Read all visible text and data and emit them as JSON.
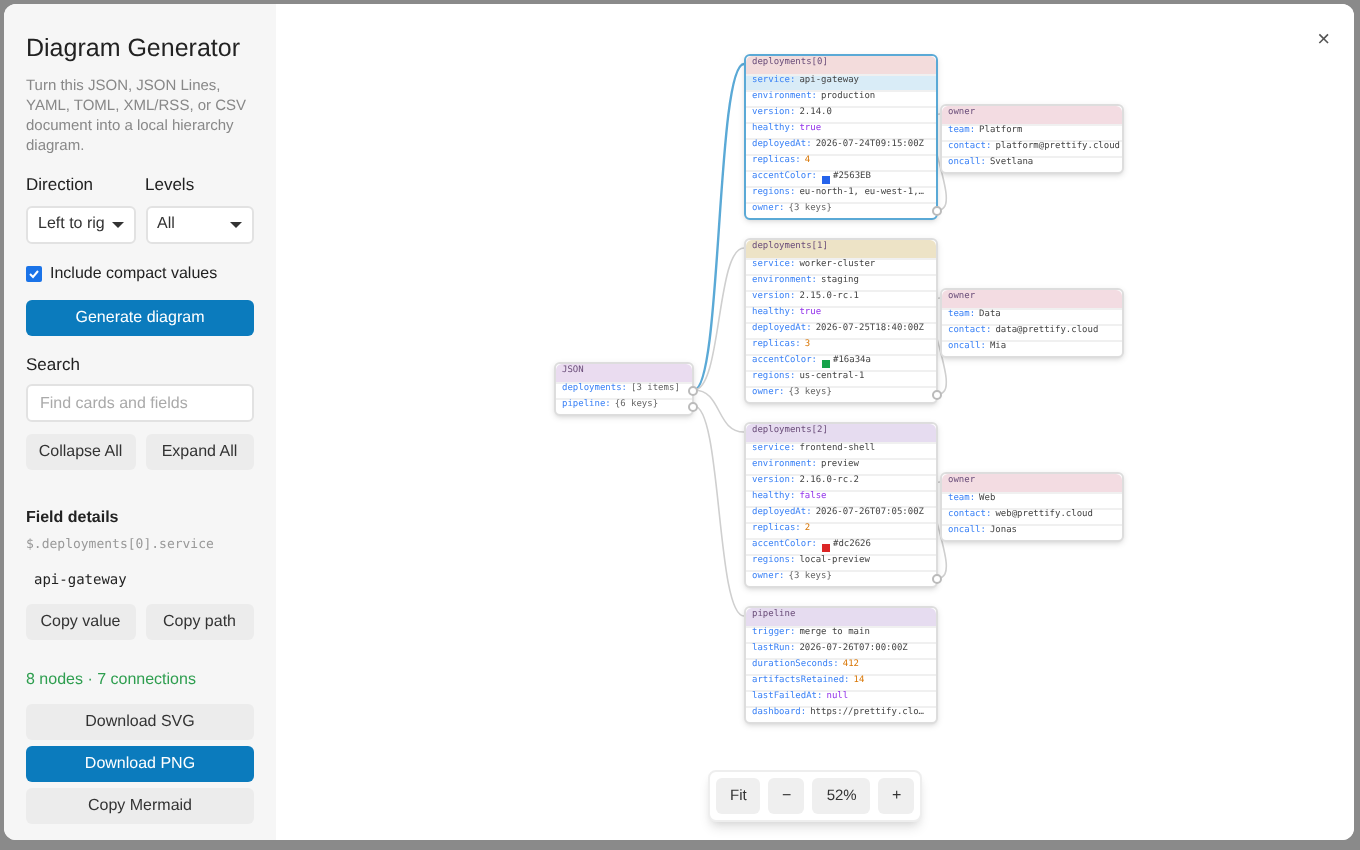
{
  "sidebar": {
    "title": "Diagram Generator",
    "description": "Turn this JSON, JSON Lines, YAML, TOML, XML/RSS, or CSV document into a local hierarchy diagram.",
    "direction": {
      "label": "Direction",
      "value": "Left to rig"
    },
    "levels": {
      "label": "Levels",
      "value": "All"
    },
    "compact": {
      "label": "Include compact values",
      "checked": true
    },
    "generate_button": "Generate diagram",
    "search": {
      "label": "Search",
      "placeholder": "Find cards and fields"
    },
    "tree_buttons": [
      "Collapse All",
      "Expand All"
    ],
    "field_details": {
      "title": "Field details",
      "path": "$.deployments[0].service",
      "value": "api-gateway"
    },
    "copy_buttons": [
      "Copy value",
      "Copy path"
    ],
    "stats": "8 nodes · 7 connections",
    "export_buttons": [
      {
        "label": "Download SVG",
        "kind": "secondary"
      },
      {
        "label": "Download PNG",
        "kind": "primary"
      },
      {
        "label": "Copy Mermaid",
        "kind": "secondary"
      }
    ]
  },
  "diagram": {
    "root": {
      "title": "JSON",
      "color": "#eadcf0",
      "selected": false,
      "rows": [
        {
          "key": "deployments:",
          "value": "[3 items]",
          "kind": "ref",
          "selected": false,
          "children": [
            {
              "title": "deployments[0]",
              "color": "#f3dcdc",
              "selected": true,
              "rows": [
                {
                  "key": "service:",
                  "value": "api-gateway",
                  "kind": "string",
                  "selected": true
                },
                {
                  "key": "environment:",
                  "value": "production",
                  "kind": "string",
                  "selected": false
                },
                {
                  "key": "version:",
                  "value": "2.14.0",
                  "kind": "string",
                  "selected": false
                },
                {
                  "key": "healthy:",
                  "value": "true",
                  "kind": "boolean",
                  "selected": false
                },
                {
                  "key": "deployedAt:",
                  "value": "2026-07-24T09:15:00Z",
                  "kind": "string",
                  "selected": false
                },
                {
                  "key": "replicas:",
                  "value": "4",
                  "kind": "number",
                  "selected": false
                },
                {
                  "key": "accentColor:",
                  "value": "#2563EB",
                  "kind": "color",
                  "color": "#2563eb",
                  "selected": false
                },
                {
                  "key": "regions:",
                  "value": "eu-north-1, eu-west-1,…",
                  "kind": "string",
                  "selected": false
                },
                {
                  "key": "owner:",
                  "value": "{3 keys}",
                  "kind": "ref",
                  "selected": false,
                  "children": [
                    {
                      "title": "owner",
                      "color": "#f3dce2",
                      "selected": false,
                      "rows": [
                        {
                          "key": "team:",
                          "value": "Platform",
                          "kind": "string",
                          "selected": false
                        },
                        {
                          "key": "contact:",
                          "value": "platform@prettify.cloud",
                          "kind": "string",
                          "selected": false
                        },
                        {
                          "key": "oncall:",
                          "value": "Svetlana",
                          "kind": "string",
                          "selected": false
                        }
                      ]
                    }
                  ]
                }
              ]
            },
            {
              "title": "deployments[1]",
              "color": "#ede3c6",
              "selected": false,
              "rows": [
                {
                  "key": "service:",
                  "value": "worker-cluster",
                  "kind": "string",
                  "selected": false
                },
                {
                  "key": "environment:",
                  "value": "staging",
                  "kind": "string",
                  "selected": false
                },
                {
                  "key": "version:",
                  "value": "2.15.0-rc.1",
                  "kind": "string",
                  "selected": false
                },
                {
                  "key": "healthy:",
                  "value": "true",
                  "kind": "boolean",
                  "selected": false
                },
                {
                  "key": "deployedAt:",
                  "value": "2026-07-25T18:40:00Z",
                  "kind": "string",
                  "selected": false
                },
                {
                  "key": "replicas:",
                  "value": "3",
                  "kind": "number",
                  "selected": false
                },
                {
                  "key": "accentColor:",
                  "value": "#16a34a",
                  "kind": "color",
                  "color": "#16a34a",
                  "selected": false
                },
                {
                  "key": "regions:",
                  "value": "us-central-1",
                  "kind": "string",
                  "selected": false
                },
                {
                  "key": "owner:",
                  "value": "{3 keys}",
                  "kind": "ref",
                  "selected": false,
                  "children": [
                    {
                      "title": "owner",
                      "color": "#f3dce2",
                      "selected": false,
                      "rows": [
                        {
                          "key": "team:",
                          "value": "Data",
                          "kind": "string",
                          "selected": false
                        },
                        {
                          "key": "contact:",
                          "value": "data@prettify.cloud",
                          "kind": "string",
                          "selected": false
                        },
                        {
                          "key": "oncall:",
                          "value": "Mia",
                          "kind": "string",
                          "selected": false
                        }
                      ]
                    }
                  ]
                }
              ]
            },
            {
              "title": "deployments[2]",
              "color": "#e6dcf0",
              "selected": false,
              "rows": [
                {
                  "key": "service:",
                  "value": "frontend-shell",
                  "kind": "string",
                  "selected": false
                },
                {
                  "key": "environment:",
                  "value": "preview",
                  "kind": "string",
                  "selected": false
                },
                {
                  "key": "version:",
                  "value": "2.16.0-rc.2",
                  "kind": "string",
                  "selected": false
                },
                {
                  "key": "healthy:",
                  "value": "false",
                  "kind": "boolean",
                  "selected": false
                },
                {
                  "key": "deployedAt:",
                  "value": "2026-07-26T07:05:00Z",
                  "kind": "string",
                  "selected": false
                },
                {
                  "key": "replicas:",
                  "value": "2",
                  "kind": "number",
                  "selected": false
                },
                {
                  "key": "accentColor:",
                  "value": "#dc2626",
                  "kind": "color",
                  "color": "#dc2626",
                  "selected": false
                },
                {
                  "key": "regions:",
                  "value": "local-preview",
                  "kind": "string",
                  "selected": false
                },
                {
                  "key": "owner:",
                  "value": "{3 keys}",
                  "kind": "ref",
                  "selected": false,
                  "children": [
                    {
                      "title": "owner",
                      "color": "#f3dce2",
                      "selected": false,
                      "rows": [
                        {
                          "key": "team:",
                          "value": "Web",
                          "kind": "string",
                          "selected": false
                        },
                        {
                          "key": "contact:",
                          "value": "web@prettify.cloud",
                          "kind": "string",
                          "selected": false
                        },
                        {
                          "key": "oncall:",
                          "value": "Jonas",
                          "kind": "string",
                          "selected": false
                        }
                      ]
                    }
                  ]
                }
              ]
            }
          ]
        },
        {
          "key": "pipeline:",
          "value": "{6 keys}",
          "kind": "ref",
          "selected": false,
          "children": [
            {
              "title": "pipeline",
              "color": "#e6dcf0",
              "selected": false,
              "rows": [
                {
                  "key": "trigger:",
                  "value": "merge to main",
                  "kind": "string",
                  "selected": false
                },
                {
                  "key": "lastRun:",
                  "value": "2026-07-26T07:00:00Z",
                  "kind": "string",
                  "selected": false
                },
                {
                  "key": "durationSeconds:",
                  "value": "412",
                  "kind": "number",
                  "selected": false
                },
                {
                  "key": "artifactsRetained:",
                  "value": "14",
                  "kind": "number",
                  "selected": false
                },
                {
                  "key": "lastFailedAt:",
                  "value": "null",
                  "kind": "null",
                  "selected": false
                },
                {
                  "key": "dashboard:",
                  "value": "https://prettify.clo…",
                  "kind": "string",
                  "selected": false
                }
              ]
            }
          ]
        }
      ]
    }
  },
  "zoom": {
    "fit": "Fit",
    "minus": "−",
    "level": "52%",
    "plus": "+"
  },
  "close": "×"
}
